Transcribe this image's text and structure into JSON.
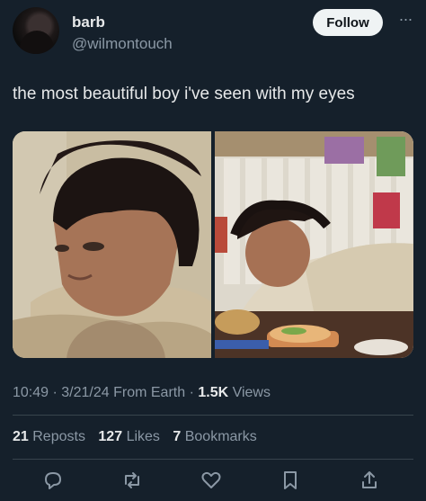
{
  "user": {
    "name": "barb",
    "handle": "@wilmontouch"
  },
  "follow_label": "Follow",
  "more_label": "···",
  "tweet_text": "the most beautiful boy i've seen with my eyes",
  "meta": {
    "time": "10:49",
    "date": "3/21/24",
    "source": "From Earth",
    "views_count": "1.5K",
    "views_label": "Views"
  },
  "stats": {
    "reposts_count": "21",
    "reposts_label": "Reposts",
    "likes_count": "127",
    "likes_label": "Likes",
    "bookmarks_count": "7",
    "bookmarks_label": "Bookmarks"
  },
  "icons": [
    "reply-icon",
    "repost-icon",
    "like-icon",
    "bookmark-icon",
    "share-icon"
  ],
  "colors": {
    "background": "#15202b",
    "text": "#e7e9ea",
    "muted": "#8b98a5",
    "divider": "#38444d",
    "follow_bg": "#eff3f4"
  }
}
